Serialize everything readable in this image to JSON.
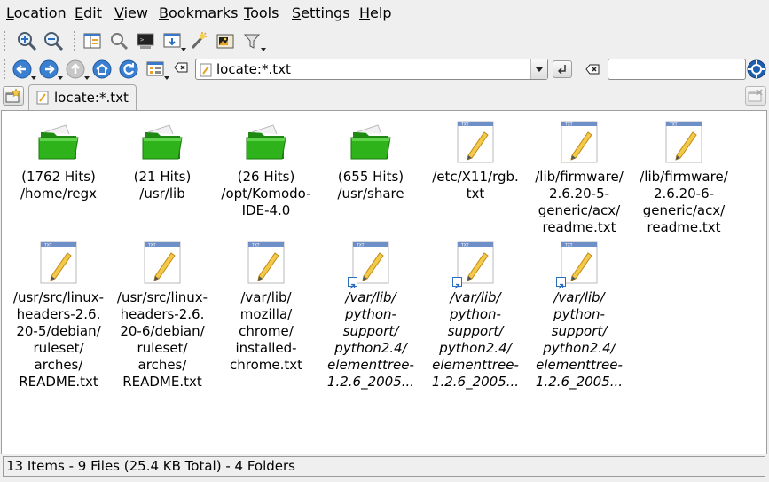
{
  "menubar": {
    "items": [
      "Location",
      "Edit",
      "View",
      "Bookmarks",
      "Tools",
      "Settings",
      "Help"
    ]
  },
  "toolbar": {
    "buttons": [
      "zoom-in-icon",
      "zoom-out-icon",
      "split-view-icon",
      "find-icon",
      "terminal-icon",
      "view-mode-icon",
      "wand-icon",
      "image-gallery-icon",
      "filter-icon"
    ],
    "nav_buttons": [
      "back-icon",
      "forward-icon",
      "up-icon",
      "home-icon",
      "reload-icon",
      "view-icon"
    ]
  },
  "location_bar": {
    "value": "locate:*.txt"
  },
  "search_bar": {
    "value": ""
  },
  "tabs": [
    {
      "label": "locate:*.txt"
    }
  ],
  "files": [
    {
      "type": "folder",
      "label": "(1762 Hits)\n/home/regx"
    },
    {
      "type": "folder",
      "label": "(21 Hits)\n/usr/lib"
    },
    {
      "type": "folder",
      "label": "(26 Hits)\n/opt/Komodo-\nIDE-4.0"
    },
    {
      "type": "folder",
      "label": "(655 Hits)\n/usr/share"
    },
    {
      "type": "text",
      "label": "/etc/X11/rgb.\ntxt"
    },
    {
      "type": "text",
      "label": "/lib/firmware/\n2.6.20-5-\ngeneric/acx/\nreadme.txt"
    },
    {
      "type": "text",
      "label": "/lib/firmware/\n2.6.20-6-\ngeneric/acx/\nreadme.txt"
    },
    {
      "type": "text",
      "label": "/usr/src/linux-\nheaders-2.6.\n20-5/debian/\nruleset/\narches/\nREADME.txt"
    },
    {
      "type": "text",
      "label": "/usr/src/linux-\nheaders-2.6.\n20-6/debian/\nruleset/\narches/\nREADME.txt"
    },
    {
      "type": "text",
      "label": "/var/lib/\nmozilla/\nchrome/\ninstalled-\nchrome.txt"
    },
    {
      "type": "link",
      "label": "/var/lib/\npython-\nsupport/\npython2.4/\nelementtree-\n1.2.6_2005..."
    },
    {
      "type": "link",
      "label": "/var/lib/\npython-\nsupport/\npython2.4/\nelementtree-\n1.2.6_2005..."
    },
    {
      "type": "link",
      "label": "/var/lib/\npython-\nsupport/\npython2.4/\nelementtree-\n1.2.6_2005..."
    }
  ],
  "status": "13 Items - 9 Files (25.4 KB Total) - 4 Folders",
  "colors": {
    "folder_green": "#2fb31a",
    "link_blue": "#2a6fbf",
    "accent_orange": "#e8a12a"
  }
}
